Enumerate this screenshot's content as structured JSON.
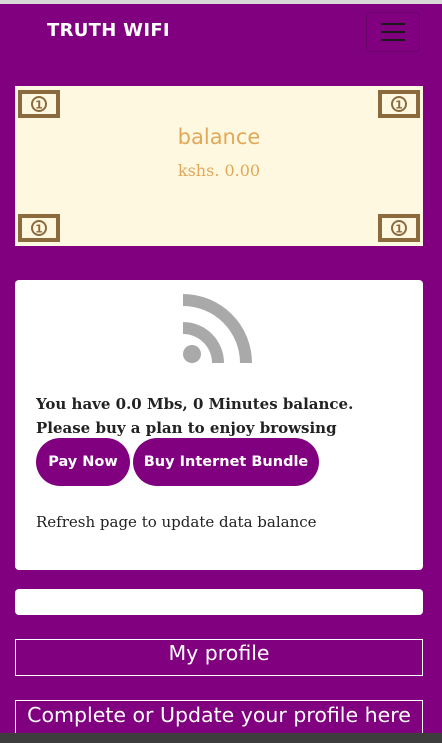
{
  "navbar": {
    "brand": "TRUTH WIFI",
    "menu_icon": "hamburger-menu-icon"
  },
  "balance_card": {
    "title": "balance",
    "amount": "kshs. 0.00",
    "decoration_icon": "dollar-bill-icon",
    "bill_value": "1"
  },
  "data_card": {
    "icon": "rss-feed-icon",
    "message_line1": "You have 0.0 Mbs, 0 Minutes balance.",
    "message_line2": "Please buy a plan to enjoy browsing",
    "pay_now_label": "Pay Now",
    "buy_bundle_label": "Buy Internet Bundle",
    "refresh_text": "Refresh page to update data balance"
  },
  "profile": {
    "heading": "My profile",
    "update_text": "Complete or Update your profile here"
  },
  "colors": {
    "brand_purple": "#800080",
    "balance_bg": "#fff8e1",
    "balance_text": "#e2a857",
    "bill_brown": "#8b6a3e",
    "icon_gray": "#a9a9a9"
  }
}
